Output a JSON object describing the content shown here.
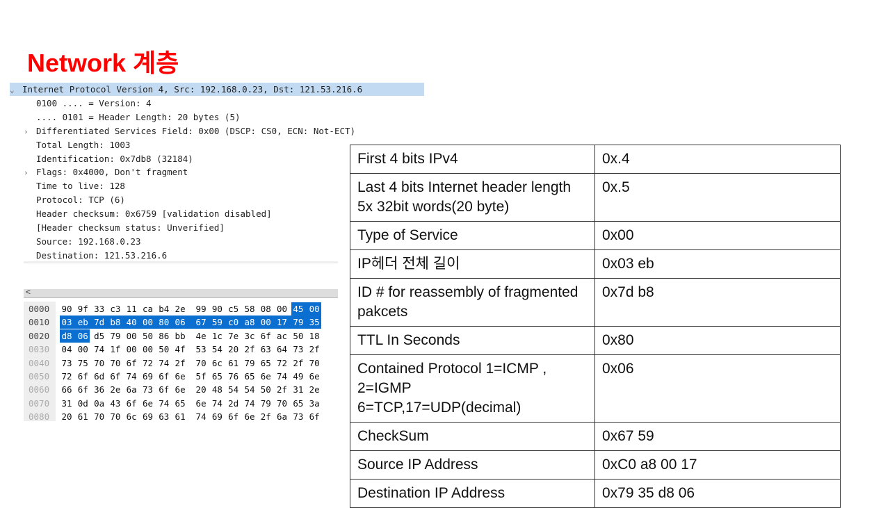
{
  "title": "Network 계층",
  "tree": [
    {
      "text": "Internet Protocol Version 4, Src: 192.168.0.23, Dst: 121.53.216.6",
      "arrow": "⌄",
      "indent": 0,
      "selected": true
    },
    {
      "text": "0100 .... = Version: 4",
      "arrow": "",
      "indent": 1
    },
    {
      "text": ".... 0101 = Header Length: 20 bytes (5)",
      "arrow": "",
      "indent": 1
    },
    {
      "text": "Differentiated Services Field: 0x00 (DSCP: CS0, ECN: Not-ECT)",
      "arrow": "›",
      "indent": 1
    },
    {
      "text": "Total Length: 1003",
      "arrow": "",
      "indent": 1
    },
    {
      "text": "Identification: 0x7db8 (32184)",
      "arrow": "",
      "indent": 1
    },
    {
      "text": "Flags: 0x4000, Don't fragment",
      "arrow": "›",
      "indent": 1
    },
    {
      "text": "Time to live: 128",
      "arrow": "",
      "indent": 1
    },
    {
      "text": "Protocol: TCP (6)",
      "arrow": "",
      "indent": 1
    },
    {
      "text": "Header checksum: 0x6759 [validation disabled]",
      "arrow": "",
      "indent": 1
    },
    {
      "text": "[Header checksum status: Unverified]",
      "arrow": "",
      "indent": 1
    },
    {
      "text": "Source: 192.168.0.23",
      "arrow": "",
      "indent": 1
    },
    {
      "text": "Destination: 121.53.216.6",
      "arrow": "",
      "indent": 1
    }
  ],
  "hex": [
    {
      "offset": "0000",
      "bytes": "90 9f 33 c3 11 ca b4 2e 99 90 c5 58 08 00 45 00",
      "hl_from": 14,
      "hl_to": 16
    },
    {
      "offset": "0010",
      "bytes": "03 eb 7d b8 40 00 80 06 67 59 c0 a8 00 17 79 35",
      "hl_from": 0,
      "hl_to": 16
    },
    {
      "offset": "0020",
      "bytes": "d8 06 d5 79 00 50 86 bb 4e 1c 7e 3c 6f ac 50 18",
      "hl_from": 0,
      "hl_to": 2
    },
    {
      "offset": "0030",
      "bytes": "04 00 74 1f 00 00 50 4f 53 54 20 2f 63 64 73 2f",
      "hl_from": 0,
      "hl_to": 0,
      "dim": true
    },
    {
      "offset": "0040",
      "bytes": "73 75 70 70 6f 72 74 2f 70 6c 61 79 65 72 2f 70",
      "hl_from": 0,
      "hl_to": 0,
      "dim": true
    },
    {
      "offset": "0050",
      "bytes": "72 6f 6d 6f 74 69 6f 6e 5f 65 76 65 6e 74 49 6e",
      "hl_from": 0,
      "hl_to": 0,
      "dim": true
    },
    {
      "offset": "0060",
      "bytes": "66 6f 36 2e 6a 73 6f 6e 20 48 54 54 50 2f 31 2e",
      "hl_from": 0,
      "hl_to": 0,
      "dim": true
    },
    {
      "offset": "0070",
      "bytes": "31 0d 0a 43 6f 6e 74 65 6e 74 2d 74 79 70 65 3a",
      "hl_from": 0,
      "hl_to": 0,
      "dim": true
    },
    {
      "offset": "0080",
      "bytes": "20 61 70 70 6c 69 63 61 74 69 6f 6e 2f 6a 73 6f",
      "hl_from": 0,
      "hl_to": 0,
      "dim": true
    }
  ],
  "scroll_left_label": "<",
  "table": [
    {
      "field": "First 4 bits IPv4",
      "value": "0x.4"
    },
    {
      "field": "Last 4 bits Internet header length 5x 32bit words(20 byte)",
      "value": "0x.5"
    },
    {
      "field": "Type of Service",
      "value": "0x00"
    },
    {
      "field": "IP헤더 전체 길이",
      "value": "0x03 eb"
    },
    {
      "field": "ID # for reassembly of fragmented pakcets",
      "value": "0x7d b8"
    },
    {
      "field": "TTL In Seconds",
      "value": "0x80"
    },
    {
      "field": "Contained Protocol 1=ICMP , 2=IGMP\n6=TCP,17=UDP(decimal)",
      "value": "0x06"
    },
    {
      "field": "CheckSum",
      "value": "0x67 59"
    },
    {
      "field": "Source IP Address",
      "value": "0xC0 a8 00 17"
    },
    {
      "field": "Destination IP Address",
      "value": "0x79 35 d8 06"
    }
  ],
  "colors": {
    "title": "#ff0000",
    "selection": "#c3dbf2",
    "hex_highlight": "#0a6fd0"
  }
}
